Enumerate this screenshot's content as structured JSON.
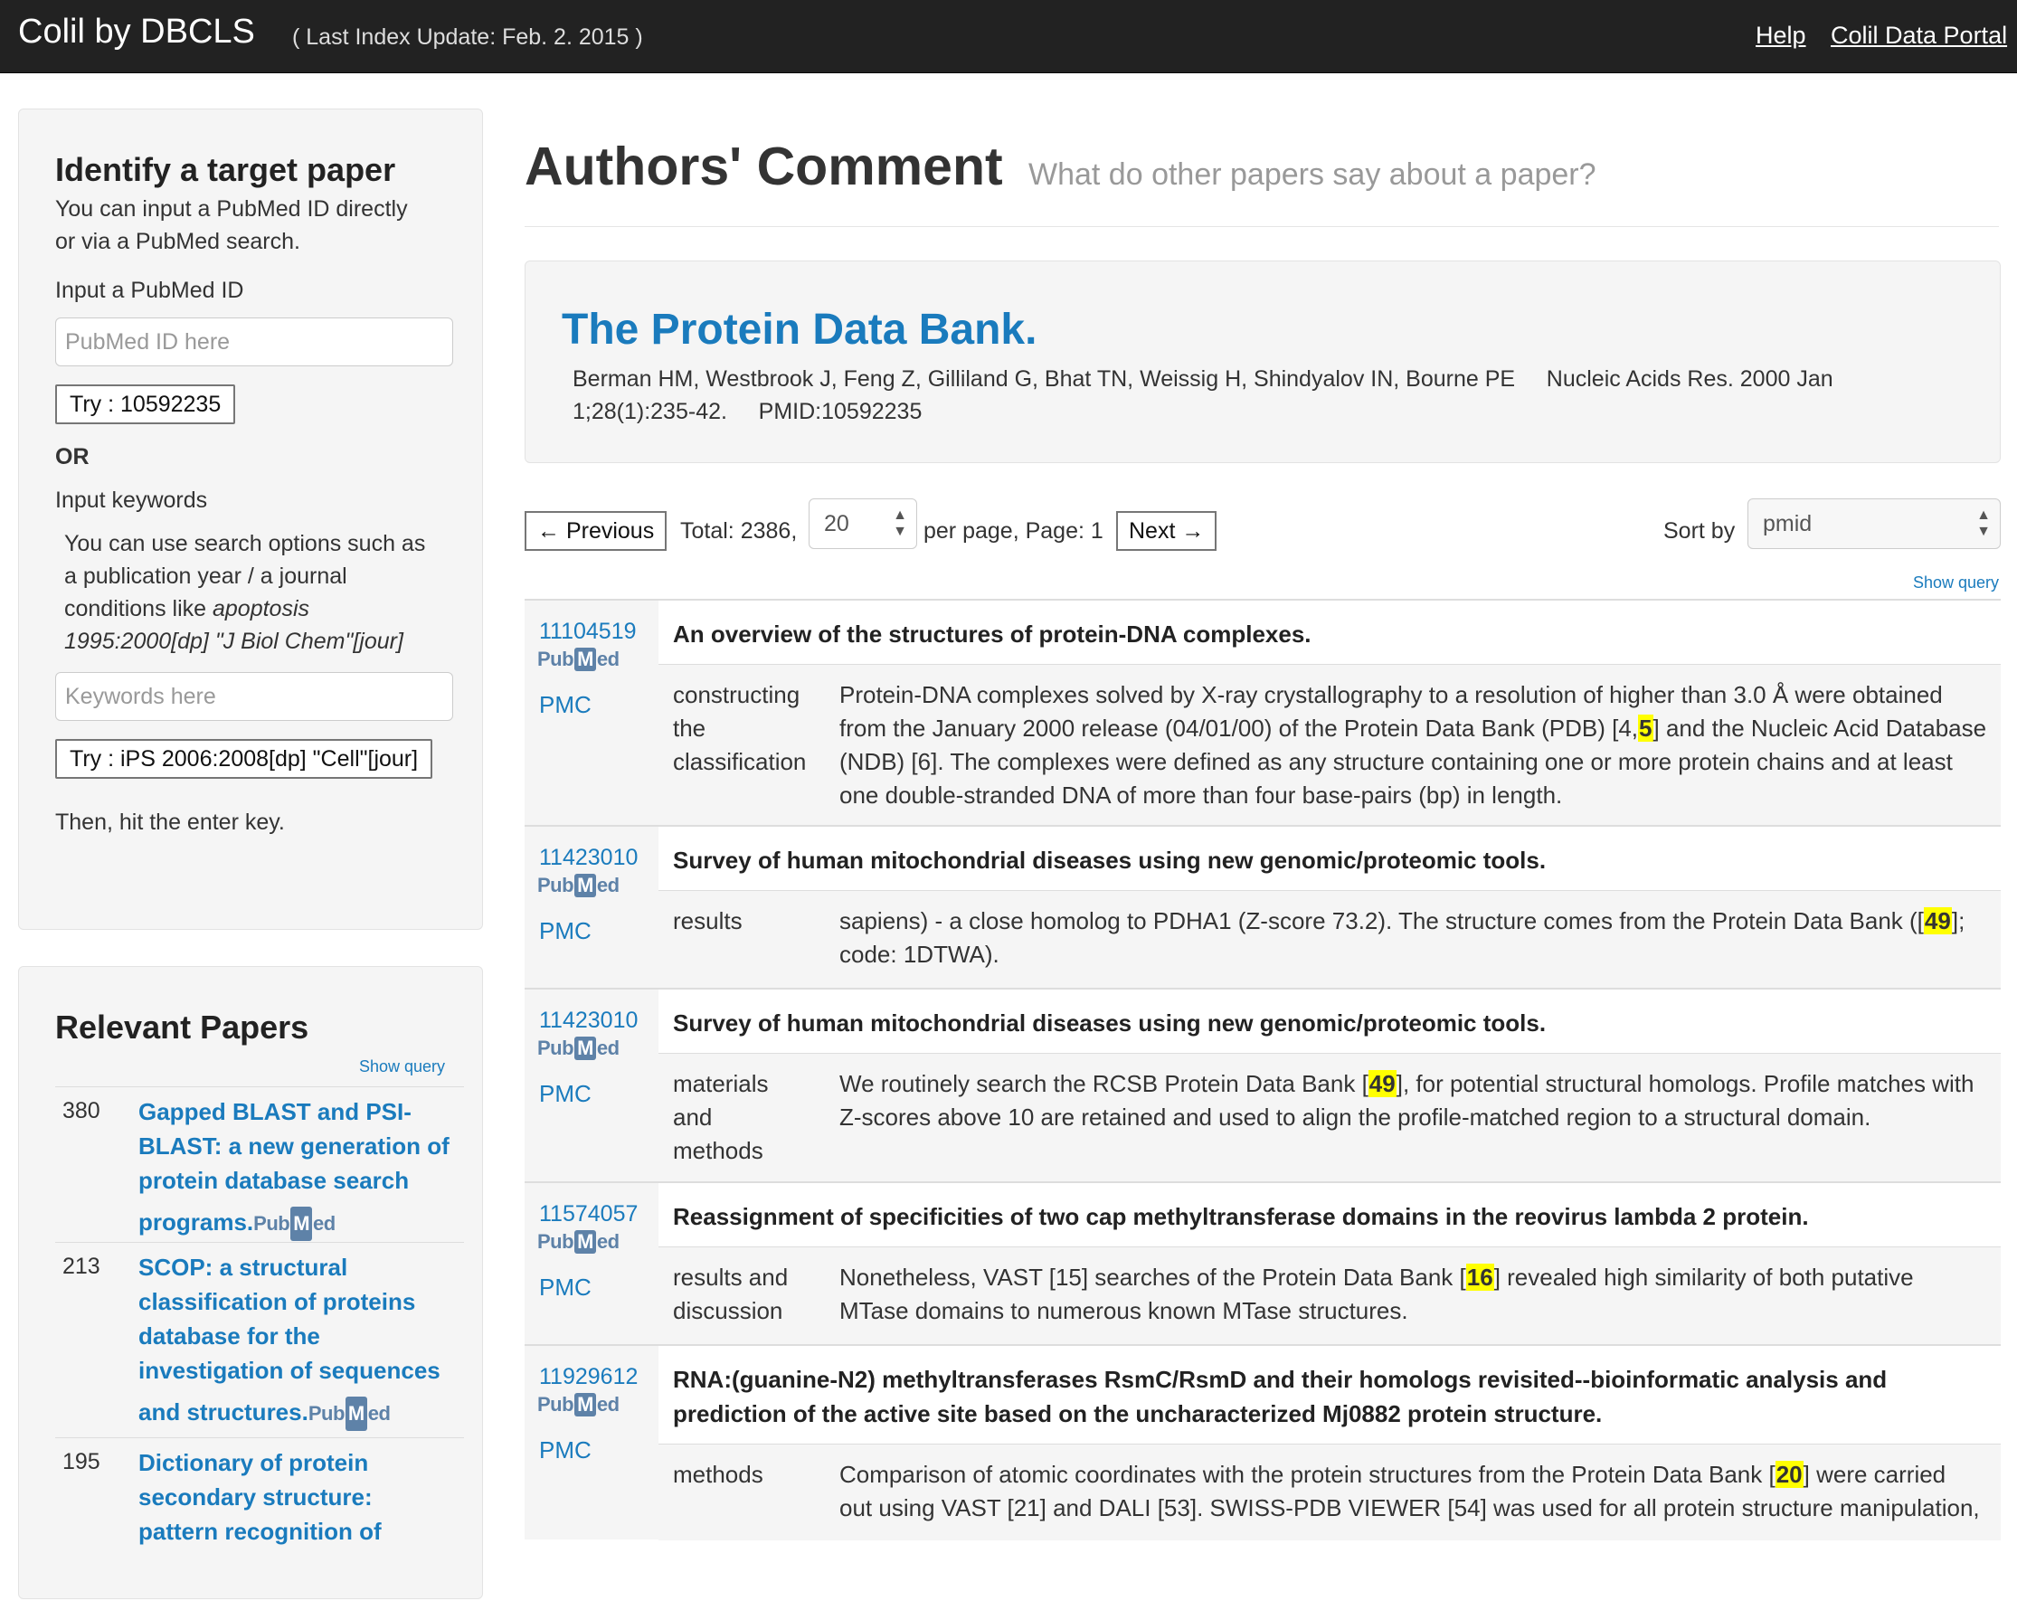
{
  "navbar": {
    "brand": "Colil by DBCLS",
    "last_update": "( Last Index Update: Feb. 2. 2015 )",
    "links": [
      "Help",
      "Colil Data Portal"
    ]
  },
  "identify": {
    "heading": "Identify a target paper",
    "intro_line1": "You can input a PubMed ID directly",
    "intro_line2": "or via a PubMed search.",
    "pmid_label": "Input a PubMed ID",
    "pmid_placeholder": "PubMed ID here",
    "try_pmid": "Try : 10592235",
    "or": "OR",
    "keywords_label": "Input keywords",
    "help_line1": "You can use search options such as",
    "help_line2": "a publication year / a journal",
    "help_line3_prefix": "conditions like ",
    "help_line3_italic": "apoptosis",
    "help_line4": "1995:2000[dp] \"J Biol Chem\"[jour]",
    "keywords_placeholder": "Keywords here",
    "try_keywords": "Try : iPS 2006:2008[dp] \"Cell\"[jour]",
    "hint": "Then, hit the enter key."
  },
  "relevant": {
    "heading": "Relevant Papers",
    "show_query": "Show query",
    "items": [
      {
        "count": "380",
        "title": [
          "Gapped BLAST and PSI-",
          "BLAST: a new generation of",
          "protein database search",
          "programs."
        ]
      },
      {
        "count": "213",
        "title": [
          "SCOP: a structural",
          "classification of proteins",
          "database for the",
          "investigation of sequences",
          "and structures."
        ]
      },
      {
        "count": "195",
        "title": [
          "Dictionary of protein",
          "secondary structure:",
          "pattern recognition of"
        ]
      }
    ]
  },
  "main": {
    "title": "Authors' Comment",
    "subtitle": "What do other papers say about a paper?",
    "paper": {
      "title": "The Protein Data Bank.",
      "meta_line1": "Berman HM, Westbrook J, Feng Z, Gilliland G, Bhat TN, Weissig H, Shindyalov IN, Bourne PE     Nucleic Acids Res. 2000 Jan",
      "meta_line2": "1;28(1):235-42.     PMID:10592235"
    },
    "pager": {
      "prev": "← Previous",
      "total": "Total: 2386,",
      "per_page_value": "20",
      "per_page_text": "per page, Page: 1",
      "next": "Next →",
      "sort_label": "Sort by",
      "sort_value": "pmid",
      "show_query": "Show query"
    },
    "pubmed_logo": {
      "pub": "Pub",
      "m": "M",
      "ed": "ed"
    },
    "pmc_label": "PMC",
    "results": [
      {
        "pmid": "11104519",
        "title": "An overview of the structures of protein-DNA complexes.",
        "section": [
          "constructing",
          "the",
          "classification"
        ],
        "snippet": [
          "Protein-DNA complexes solved by X-ray crystallography to a resolution of higher than 3.0 Å were obtained",
          "from the January 2000 release (04/01/00) of the Protein Data Bank (PDB) [4,",
          "5",
          "] and the Nucleic Acid Database",
          "(NDB) [6]. The complexes were defined as any structure containing one or more protein chains and at least",
          "one double-stranded DNA of more than four base-pairs (bp) in length."
        ]
      },
      {
        "pmid": "11423010",
        "title": "Survey of human mitochondrial diseases using new genomic/proteomic tools.",
        "section": [
          "results"
        ],
        "snippet": [
          "sapiens) - a close homolog to PDHA1 (Z-score 73.2). The structure comes from the Protein Data Bank ([",
          "49",
          "];",
          "code: 1DTWA)."
        ]
      },
      {
        "pmid": "11423010",
        "title": "Survey of human mitochondrial diseases using new genomic/proteomic tools.",
        "section": [
          "materials",
          "and",
          "methods"
        ],
        "snippet": [
          "We routinely search the RCSB Protein Data Bank [",
          "49",
          "], for potential structural homologs. Profile matches with",
          "Z-scores above 10 are retained and used to align the profile-matched region to a structural domain."
        ]
      },
      {
        "pmid": "11574057",
        "title": "Reassignment of specificities of two cap methyltransferase domains in the reovirus lambda 2 protein.",
        "section": [
          "results and",
          "discussion"
        ],
        "snippet": [
          "Nonetheless, VAST [15] searches of the Protein Data Bank [",
          "16",
          "] revealed high similarity of both putative",
          "MTase domains to numerous known MTase structures."
        ]
      },
      {
        "pmid": "11929612",
        "title_line1": "RNA:(guanine-N2) methyltransferases RsmC/RsmD and their homologs revisited--bioinformatic analysis and",
        "title_line2": "prediction of the active site based on the uncharacterized Mj0882 protein structure.",
        "section": [
          "methods"
        ],
        "snippet": [
          "Comparison of atomic coordinates with the protein structures from the Protein Data Bank [",
          "20",
          "] were carried",
          "out using VAST [21] and DALI [53]. SWISS-PDB VIEWER [54] was used for all protein structure manipulation,"
        ]
      }
    ]
  },
  "colors": {
    "navbar": "#222222",
    "link_blue": "#1a7bbd",
    "highlight": "#ffff00",
    "panel_bg": "#f5f5f5"
  }
}
